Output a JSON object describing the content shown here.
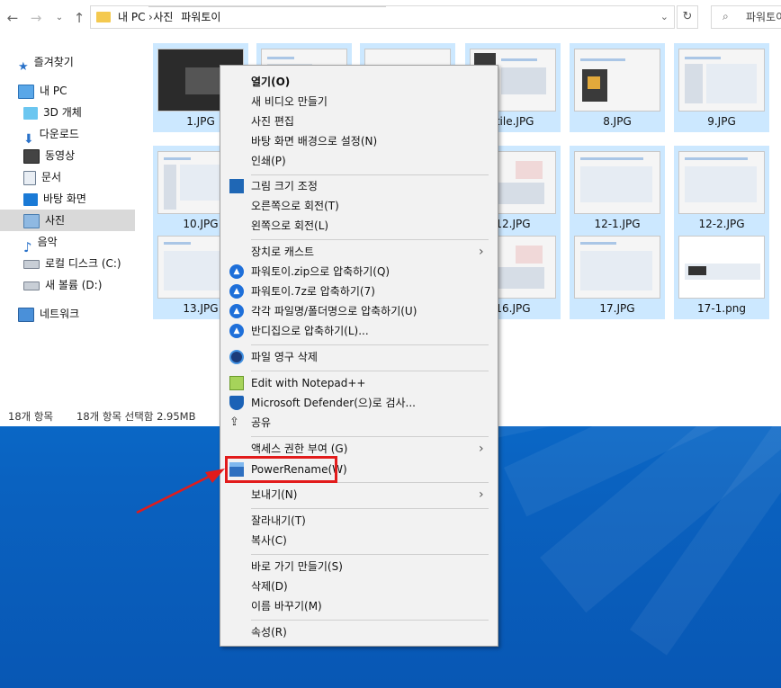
{
  "address": {
    "crumbs": [
      "내 PC",
      "사진",
      "파워토이"
    ],
    "search_placeholder": "파워토이"
  },
  "sidebar": {
    "items": [
      {
        "label": "즐겨찾기",
        "icon": "star-icon"
      },
      {
        "label": "내 PC",
        "icon": "computer-icon"
      },
      {
        "label": "3D 개체",
        "icon": "cube-icon"
      },
      {
        "label": "다운로드",
        "icon": "download-icon"
      },
      {
        "label": "동영상",
        "icon": "video-icon"
      },
      {
        "label": "문서",
        "icon": "document-icon"
      },
      {
        "label": "바탕 화면",
        "icon": "desktop-icon"
      },
      {
        "label": "사진",
        "icon": "pictures-icon"
      },
      {
        "label": "음악",
        "icon": "music-icon"
      },
      {
        "label": "로컬 디스크 (C:)",
        "icon": "drive-icon"
      },
      {
        "label": "새 볼륨 (D:)",
        "icon": "drive-icon"
      },
      {
        "label": "네트워크",
        "icon": "network-icon"
      }
    ]
  },
  "files": [
    {
      "name": "1.JPG"
    },
    {
      "name": ""
    },
    {
      "name": ""
    },
    {
      "name": "-tile.JPG"
    },
    {
      "name": "8.JPG"
    },
    {
      "name": "9.JPG"
    },
    {
      "name": "10.JPG"
    },
    {
      "name": ""
    },
    {
      "name": ""
    },
    {
      "name": "12.JPG"
    },
    {
      "name": "12-1.JPG"
    },
    {
      "name": "12-2.JPG"
    },
    {
      "name": "13.JPG"
    },
    {
      "name": ""
    },
    {
      "name": ""
    },
    {
      "name": "16.JPG"
    },
    {
      "name": "17.JPG"
    },
    {
      "name": "17-1.png"
    }
  ],
  "status": {
    "count": "18개 항목",
    "selection": "18개 항목 선택함 2.95MB"
  },
  "context_menu": {
    "items": [
      {
        "label": "열기(O)",
        "bold": true
      },
      {
        "label": "새 비디오 만들기"
      },
      {
        "label": "사진 편집"
      },
      {
        "label": "바탕 화면 배경으로 설정(N)"
      },
      {
        "label": "인쇄(P)"
      },
      {
        "label": "그림 크기 조정",
        "icon": "resize-icon"
      },
      {
        "label": "오른쪽으로 회전(T)"
      },
      {
        "label": "왼쪽으로 회전(L)"
      },
      {
        "label": "장치로 캐스트",
        "submenu": true
      },
      {
        "label": "파워토이.zip으로 압축하기(Q)",
        "icon": "bandizip-icon"
      },
      {
        "label": "파워토이.7z로 압축하기(7)",
        "icon": "bandizip-icon"
      },
      {
        "label": "각각 파일명/폴더명으로 압축하기(U)",
        "icon": "bandizip-icon"
      },
      {
        "label": "반디집으로 압축하기(L)...",
        "icon": "bandizip-icon"
      },
      {
        "label": "파일 영구 삭제",
        "icon": "shred-icon"
      },
      {
        "label": "Edit with Notepad++",
        "icon": "notepad-icon"
      },
      {
        "label": "Microsoft Defender(으)로 검사...",
        "icon": "defender-icon"
      },
      {
        "label": "공유",
        "icon": "share-icon"
      },
      {
        "label": "액세스 권한 부여 (G)",
        "submenu": true
      },
      {
        "label": "PowerRename(W)",
        "icon": "powerrename-icon"
      },
      {
        "label": "보내기(N)",
        "submenu": true
      },
      {
        "label": "잘라내기(T)"
      },
      {
        "label": "복사(C)"
      },
      {
        "label": "바로 가기 만들기(S)"
      },
      {
        "label": "삭제(D)"
      },
      {
        "label": "이름 바꾸기(M)"
      },
      {
        "label": "속성(R)"
      }
    ]
  },
  "colors": {
    "highlight_box": "#e21b1b",
    "arrow": "#e21b1b",
    "selection": "#cce8ff"
  }
}
